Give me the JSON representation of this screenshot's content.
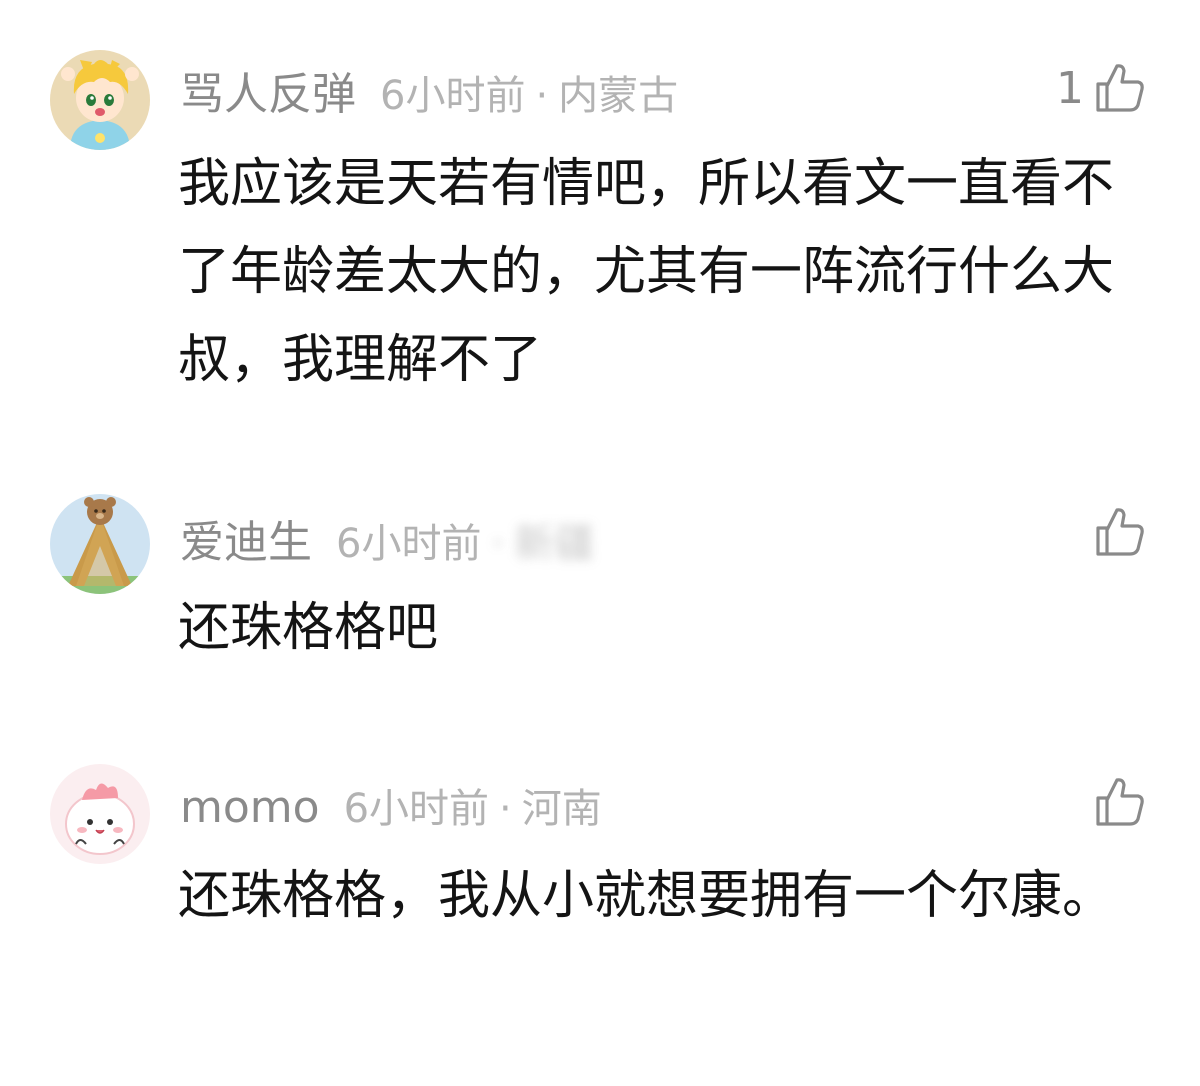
{
  "comments": [
    {
      "username": "骂人反弹",
      "time": "6小时前",
      "separator": "·",
      "location": "内蒙古",
      "like_count": "1",
      "text": "我应该是天若有情吧，所以看文一直看不了年龄差太大的，尤其有一阵流行什么大叔，我理解不了",
      "avatar_icon": "cartoon-boy-avatar",
      "like_icon": "thumbs-up-icon"
    },
    {
      "username": "爱迪生",
      "time": "6小时前",
      "separator": "·",
      "location": "新疆",
      "like_count": "",
      "text": "还珠格格吧",
      "avatar_icon": "bear-avatar",
      "like_icon": "thumbs-up-icon"
    },
    {
      "username": "momo",
      "time": "6小时前",
      "separator": "·",
      "location": "河南",
      "like_count": "",
      "text": "还珠格格，我从小就想要拥有一个尔康。",
      "avatar_icon": "pink-blob-avatar",
      "like_icon": "thumbs-up-icon"
    }
  ],
  "colors": {
    "username": "#8a8a8a",
    "meta": "#b3b3b3",
    "text": "#141414",
    "background": "#ffffff"
  }
}
